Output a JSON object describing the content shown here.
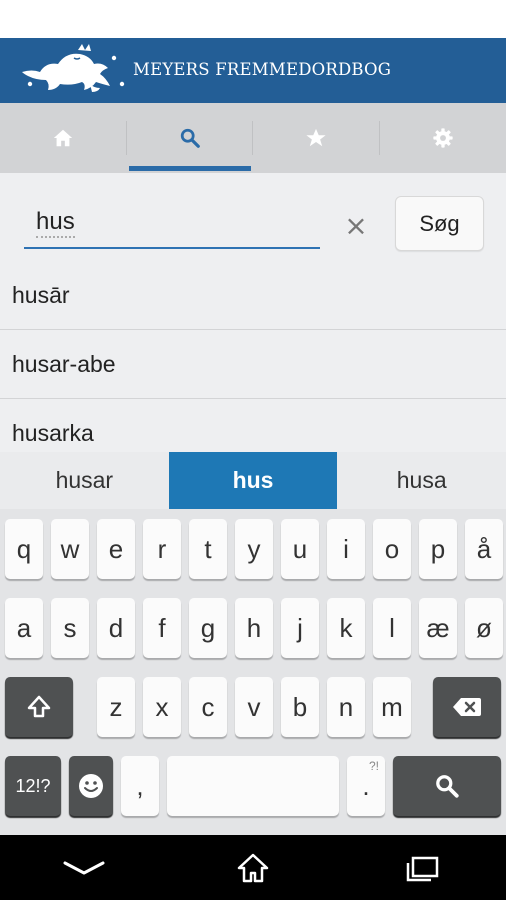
{
  "app": {
    "title": "MEYERS FREMMEDORDBOG"
  },
  "colors": {
    "header": "#235e96",
    "tab_indicator": "#2a6ba8",
    "suggestion_active": "#1e78b5",
    "keyboard_bg": "#e3e4e6"
  },
  "tabs": [
    {
      "icon": "home-icon",
      "selected": false
    },
    {
      "icon": "search-icon",
      "selected": true
    },
    {
      "icon": "star-icon",
      "selected": false
    },
    {
      "icon": "gear-icon",
      "selected": false
    }
  ],
  "search": {
    "value": "hus",
    "clear_label": "×",
    "button_label": "Søg"
  },
  "results": [
    "husār",
    "husar-abe",
    "husarka"
  ],
  "suggestions": [
    {
      "text": "husar",
      "active": false
    },
    {
      "text": "hus",
      "active": true
    },
    {
      "text": "husa",
      "active": false
    }
  ],
  "keyboard": {
    "row1": [
      "q",
      "w",
      "e",
      "r",
      "t",
      "y",
      "u",
      "i",
      "o",
      "p",
      "å"
    ],
    "row2": [
      "a",
      "s",
      "d",
      "f",
      "g",
      "h",
      "j",
      "k",
      "l",
      "æ",
      "ø"
    ],
    "row3": [
      "z",
      "x",
      "c",
      "v",
      "b",
      "n",
      "m"
    ],
    "symbols_label": "12!?",
    "comma_label": ",",
    "period_label": ".",
    "period_sub_label": "?!"
  }
}
